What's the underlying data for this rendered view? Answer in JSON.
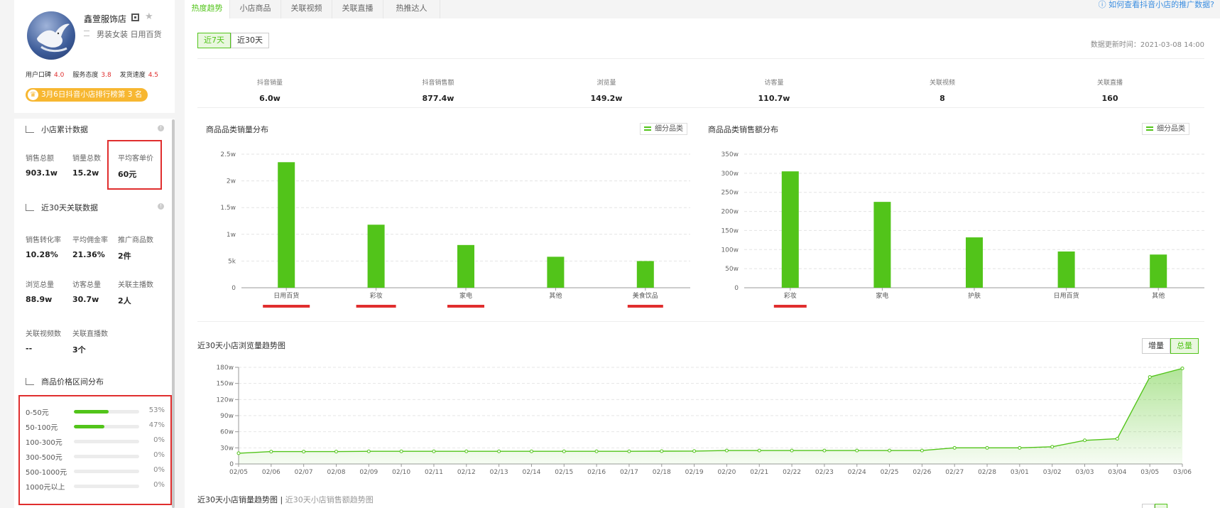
{
  "shop": {
    "name": "鑫萱服饰店",
    "category": "男装女装 日用百货",
    "ratings": [
      {
        "label": "用户口碑",
        "value": "4.0"
      },
      {
        "label": "服务态度",
        "value": "3.8"
      },
      {
        "label": "发货速度",
        "value": "4.5"
      }
    ],
    "rank_badge": "3月6日抖音小店排行榜第 3 名"
  },
  "cumulative": {
    "title": "小店累计数据",
    "metrics": [
      {
        "label": "销售总额",
        "value": "903.1w"
      },
      {
        "label": "销量总数",
        "value": "15.2w"
      },
      {
        "label": "平均客单价",
        "value": "60元"
      }
    ]
  },
  "recent30": {
    "title": "近30天关联数据",
    "metrics": [
      {
        "label": "销售转化率",
        "value": "10.28%"
      },
      {
        "label": "平均佣金率",
        "value": "21.36%"
      },
      {
        "label": "推广商品数",
        "value": "2件"
      },
      {
        "label": "浏览总量",
        "value": "88.9w"
      },
      {
        "label": "访客总量",
        "value": "30.7w"
      },
      {
        "label": "关联主播数",
        "value": "2人"
      },
      {
        "label": "关联视频数",
        "value": "--"
      },
      {
        "label": "关联直播数",
        "value": "3个"
      }
    ]
  },
  "price_dist": {
    "title": "商品价格区间分布",
    "rows": [
      {
        "label": "0-50元",
        "pct": "53%",
        "fraction": 0.53
      },
      {
        "label": "50-100元",
        "pct": "47%",
        "fraction": 0.47
      },
      {
        "label": "100-300元",
        "pct": "0%",
        "fraction": 0
      },
      {
        "label": "300-500元",
        "pct": "0%",
        "fraction": 0
      },
      {
        "label": "500-1000元",
        "pct": "0%",
        "fraction": 0
      },
      {
        "label": "1000元以上",
        "pct": "0%",
        "fraction": 0
      }
    ]
  },
  "tabs": [
    "热度趋势",
    "小店商品",
    "关联视频",
    "关联直播",
    "热推达人"
  ],
  "help_link": "如何查看抖音小店的推广数据?",
  "period_toggle": [
    "近7天",
    "近30天"
  ],
  "update_time": "数据更新时间：2021-03-08 14:00",
  "summary": [
    {
      "label": "抖音销量",
      "value": "6.0w"
    },
    {
      "label": "抖音销售额",
      "value": "877.4w"
    },
    {
      "label": "浏览量",
      "value": "149.2w"
    },
    {
      "label": "访客量",
      "value": "110.7w"
    },
    {
      "label": "关联视频",
      "value": "8"
    },
    {
      "label": "关联直播",
      "value": "160"
    }
  ],
  "sub_category_label": "细分品类",
  "trend_toggle": [
    "增量",
    "总量"
  ],
  "bottom_title": "近30天小店销量趋势图",
  "bottom_sub": "近30天小店销售额趋势图",
  "colors": {
    "accent": "#52c41a",
    "highlight": "#e02e2e",
    "rank": "#f7b731"
  },
  "chart_data": [
    {
      "type": "bar",
      "title": "商品品类销量分布",
      "categories": [
        "日用百货",
        "彩妆",
        "家电",
        "其他",
        "美食饮品"
      ],
      "values": [
        23500,
        11800,
        8000,
        5800,
        5000
      ],
      "yticks": [
        "0",
        "5k",
        "1w",
        "1.5w",
        "2w",
        "2.5w"
      ],
      "ylim": [
        0,
        25000
      ],
      "grid": true
    },
    {
      "type": "bar",
      "title": "商品品类销售额分布",
      "categories": [
        "彩妆",
        "家电",
        "护肤",
        "日用百货",
        "其他"
      ],
      "values": [
        3050000,
        2250000,
        1320000,
        950000,
        870000
      ],
      "yticks": [
        "0",
        "50w",
        "100w",
        "150w",
        "200w",
        "250w",
        "300w",
        "350w"
      ],
      "ylim": [
        0,
        3500000
      ],
      "grid": true
    },
    {
      "type": "area",
      "title": "近30天小店浏览量趋势图",
      "x": [
        "02/05",
        "02/06",
        "02/07",
        "02/08",
        "02/09",
        "02/10",
        "02/11",
        "02/12",
        "02/13",
        "02/14",
        "02/15",
        "02/16",
        "02/17",
        "02/18",
        "02/19",
        "02/20",
        "02/21",
        "02/22",
        "02/23",
        "02/24",
        "02/25",
        "02/26",
        "02/27",
        "02/28",
        "03/01",
        "03/02",
        "03/03",
        "03/04",
        "03/05",
        "03/06"
      ],
      "values": [
        200000,
        230000,
        230000,
        230000,
        235000,
        235000,
        235000,
        235000,
        235000,
        235000,
        235000,
        235000,
        235000,
        238000,
        240000,
        250000,
        250000,
        250000,
        250000,
        250000,
        250000,
        250000,
        300000,
        300000,
        300000,
        320000,
        440000,
        470000,
        1620000,
        1780000
      ],
      "yticks": [
        "0",
        "30w",
        "60w",
        "90w",
        "120w",
        "150w",
        "180w"
      ],
      "ylim": [
        0,
        1800000
      ],
      "grid": true
    }
  ]
}
